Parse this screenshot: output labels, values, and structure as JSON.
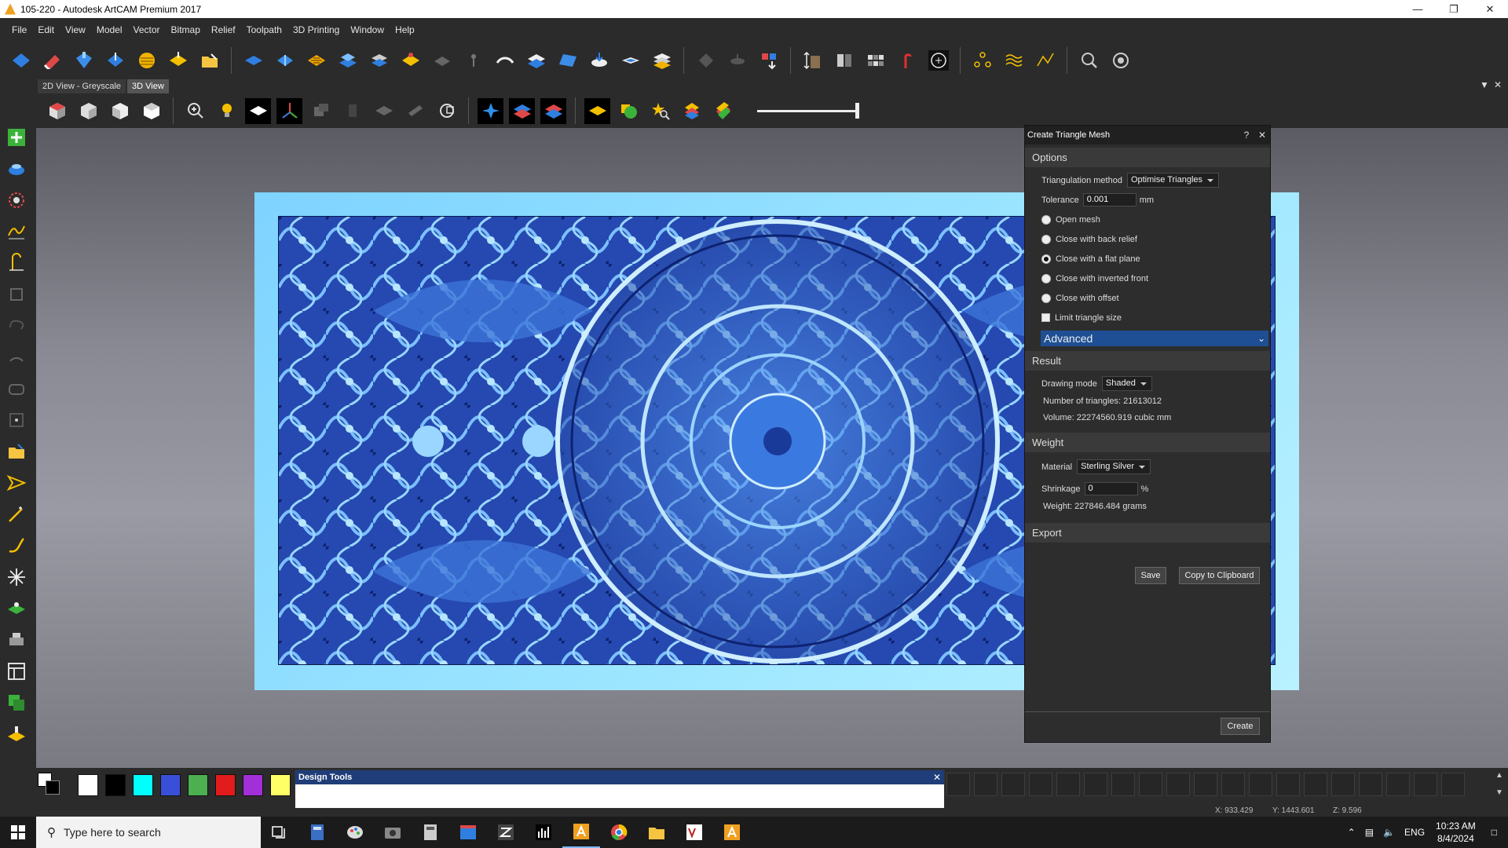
{
  "window": {
    "title": "105-220 - Autodesk ArtCAM Premium 2017",
    "controls": [
      "minimize-icon",
      "restore-icon",
      "close-icon"
    ]
  },
  "menu": [
    "File",
    "Edit",
    "View",
    "Model",
    "Vector",
    "Bitmap",
    "Relief",
    "Toolpath",
    "3D Printing",
    "Window",
    "Help"
  ],
  "view_tabs": [
    "2D View - Greyscale",
    "3D View"
  ],
  "dialog": {
    "title": "Create Triangle Mesh",
    "options": {
      "header": "Options",
      "triangulation_label": "Triangulation method",
      "triangulation_value": "Optimise Triangles",
      "tolerance_label": "Tolerance",
      "tolerance_value": "0.001",
      "tolerance_unit": "mm",
      "radios": [
        {
          "label": "Open mesh",
          "selected": false
        },
        {
          "label": "Close with back relief",
          "selected": false
        },
        {
          "label": "Close with a flat plane",
          "selected": true
        },
        {
          "label": "Close with inverted front",
          "selected": false
        },
        {
          "label": "Close with offset",
          "selected": false
        }
      ],
      "limit_label": "Limit triangle size",
      "advanced_label": "Advanced"
    },
    "result": {
      "header": "Result",
      "drawing_mode_label": "Drawing mode",
      "drawing_mode_value": "Shaded",
      "triangles_text": "Number of triangles: 21613012",
      "volume_text": "Volume: 22274560.919 cubic mm"
    },
    "weight": {
      "header": "Weight",
      "material_label": "Material",
      "material_value": "Sterling Silver",
      "shrinkage_label": "Shrinkage",
      "shrinkage_value": "0",
      "shrinkage_unit": "%",
      "weight_text": "Weight: 227846.484 grams"
    },
    "export": {
      "header": "Export",
      "save_label": "Save",
      "copy_label": "Copy to Clipboard"
    },
    "create_label": "Create"
  },
  "palette": [
    "#ffffff",
    "#000000",
    "#00ffff",
    "#3a4fd8",
    "#4caf50",
    "#e21c1c",
    "#a22fd8",
    "#ffff66"
  ],
  "design_tools_title": "Design Tools",
  "status": {
    "x": "X: 933.429",
    "y": "Y: 1443.601",
    "z": "Z: 9.596"
  },
  "taskbar": {
    "search_placeholder": "Type here to search",
    "language": "ENG",
    "time": "10:23 AM",
    "date": "8/4/2024"
  }
}
